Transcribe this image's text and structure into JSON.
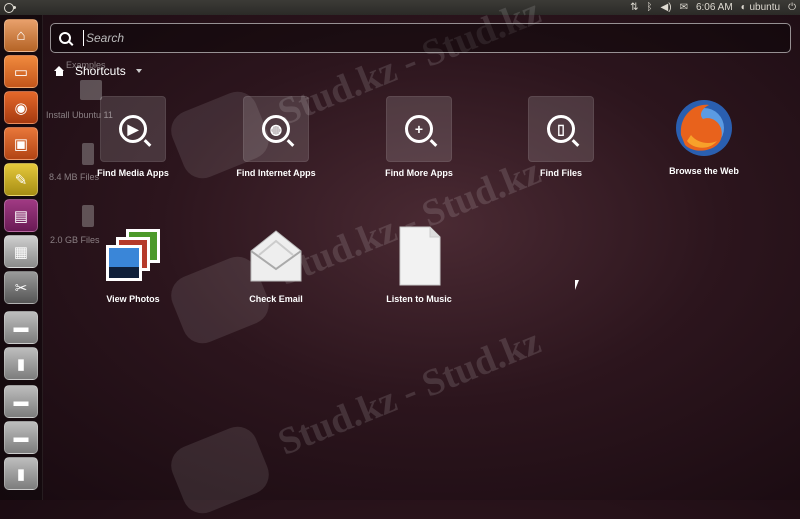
{
  "top_panel": {
    "time": "6:06 AM",
    "user": "ubuntu"
  },
  "launcher": {
    "items": [
      {
        "name": "ubuntu-one-icon",
        "glyph": "⌂"
      },
      {
        "name": "home-folder-icon",
        "glyph": "▭"
      },
      {
        "name": "firefox-icon",
        "glyph": "◉"
      },
      {
        "name": "software-center-icon",
        "glyph": "▣"
      },
      {
        "name": "text-editor-icon",
        "glyph": "✎"
      },
      {
        "name": "impress-icon",
        "glyph": "▤"
      },
      {
        "name": "files-icon",
        "glyph": "▦"
      },
      {
        "name": "settings-icon",
        "glyph": "✂"
      },
      {
        "name": "drive-icon",
        "glyph": "▬"
      },
      {
        "name": "usb-drive-icon",
        "glyph": "▮"
      },
      {
        "name": "drive-2-icon",
        "glyph": "▬"
      },
      {
        "name": "drive-3-icon",
        "glyph": "▬"
      },
      {
        "name": "usb-drive-2-icon",
        "glyph": "▮"
      }
    ]
  },
  "desktop": {
    "items": [
      {
        "label": "Examples"
      },
      {
        "label": "Install Ubuntu 11"
      },
      {
        "label": "8.4 MB Files"
      },
      {
        "label": "2.0 GB Files"
      }
    ]
  },
  "dash": {
    "search_placeholder": "Search",
    "shortcuts_label": "Shortcuts",
    "tiles": [
      {
        "label": "Find Media Apps"
      },
      {
        "label": "Find Internet Apps"
      },
      {
        "label": "Find More Apps"
      },
      {
        "label": "Find Files"
      },
      {
        "label": "Browse the Web"
      },
      {
        "label": "View Photos"
      },
      {
        "label": "Check Email"
      },
      {
        "label": "Listen to Music"
      }
    ]
  },
  "watermark": {
    "text": "Stud.kz - Stud.kz"
  }
}
